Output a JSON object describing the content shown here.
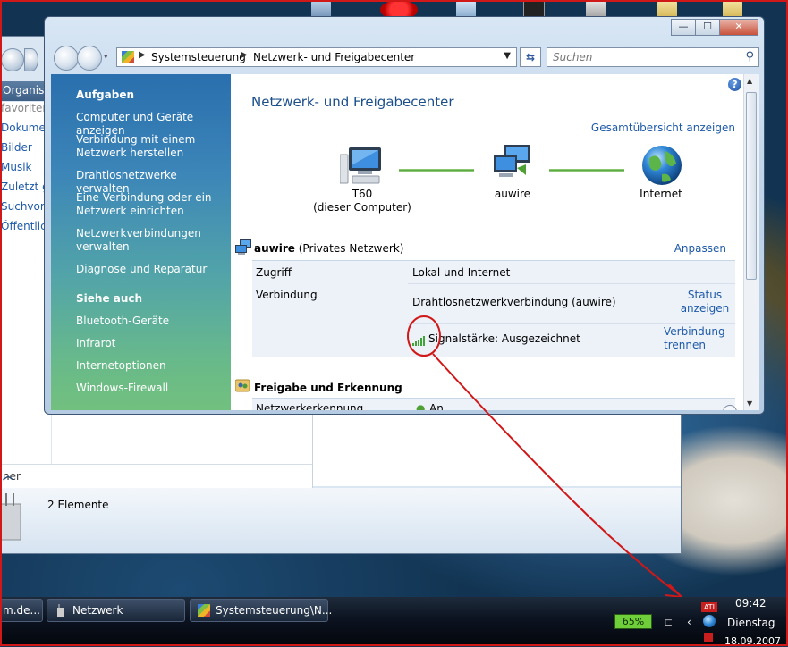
{
  "background_window": {
    "toolbar_label": "Organisie",
    "sidebar_items": [
      "favoriten",
      "Dokumen",
      "Bilder",
      "Musik",
      "Zuletzt ge",
      "Suchvorg",
      "Öffentlich"
    ],
    "folder_bar_label": "ner",
    "item_count": "2 Elemente"
  },
  "window": {
    "breadcrumb": [
      "Systemsteuerung",
      "Netzwerk- und Freigabecenter"
    ],
    "search_placeholder": "Suchen",
    "caption_buttons": {
      "minimize": "—",
      "maximize": "☐",
      "close": "✕"
    },
    "help": "?"
  },
  "tasks": {
    "heading": "Aufgaben",
    "items": [
      "Computer und Geräte anzeigen",
      "Verbindung mit einem Netzwerk herstellen",
      "Drahtlosnetzwerke verwalten",
      "Eine Verbindung oder ein Netzwerk einrichten",
      "Netzwerkverbindungen verwalten",
      "Diagnose und Reparatur"
    ],
    "see_also_heading": "Siehe auch",
    "see_also": [
      "Bluetooth-Geräte",
      "Infrarot",
      "Internetoptionen",
      "Windows-Firewall"
    ]
  },
  "main": {
    "title": "Netzwerk- und Freigabecenter",
    "overview_link": "Gesamtübersicht anzeigen",
    "nodes": [
      {
        "name": "T60",
        "sub": "(dieser Computer)",
        "icon": "computer-icon"
      },
      {
        "name": "auwire",
        "sub": "",
        "icon": "network-icon"
      },
      {
        "name": "Internet",
        "sub": "",
        "icon": "globe-icon"
      }
    ],
    "network_name": "auwire",
    "network_type": "(Privates Netzwerk)",
    "customize_link": "Anpassen",
    "rows": {
      "access_label": "Zugriff",
      "access_value": "Lokal und Internet",
      "connection_label": "Verbindung",
      "connection_value": "Drahtlosnetzwerkverbindung (auwire)",
      "status_link_1": "Status",
      "status_link_2": "anzeigen",
      "signal_value": "Signalstärke: Ausgezeichnet",
      "disconnect_link_1": "Verbindung",
      "disconnect_link_2": "trennen"
    },
    "sharing_heading": "Freigabe und Erkennung",
    "sharing_row_label": "Netzwerkerkennung",
    "sharing_row_value": "An"
  },
  "taskbar": {
    "buttons": [
      "m.de...",
      "Netzwerk",
      "Systemsteuerung\\N..."
    ],
    "battery": "65%",
    "time": "09:42",
    "day": "Dienstag",
    "date": "18.09.2007"
  },
  "colors": {
    "link": "#1e5aa8",
    "title": "#1b4f8c",
    "annotation": "#d01818",
    "connection_line": "#4fa135"
  }
}
